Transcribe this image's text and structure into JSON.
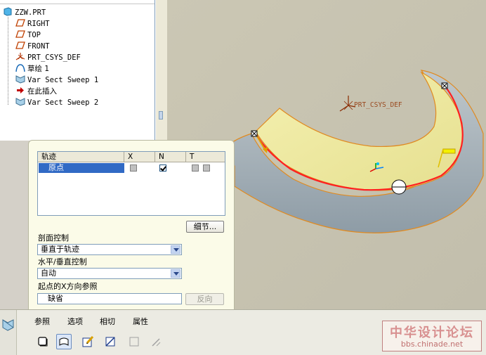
{
  "model_tree": {
    "items": [
      {
        "label": "ZZW.PRT",
        "icon": "part-icon"
      },
      {
        "label": "RIGHT",
        "icon": "datum-plane-icon"
      },
      {
        "label": "TOP",
        "icon": "datum-plane-icon"
      },
      {
        "label": "FRONT",
        "icon": "datum-plane-icon"
      },
      {
        "label": "PRT_CSYS_DEF",
        "icon": "csys-icon"
      },
      {
        "label": "草绘 1",
        "icon": "sketch-icon"
      },
      {
        "label": "Var Sect Sweep 1",
        "icon": "sweep-icon"
      },
      {
        "label": "在此插入",
        "icon": "insert-here-arrow-icon"
      },
      {
        "label": "Var Sect Sweep 2",
        "icon": "sweep-icon"
      }
    ]
  },
  "viewport": {
    "csys_label": "PRT_CSYS_DEF",
    "colors": {
      "background": "#c8c4b2",
      "surface_yellow": "#eeeaa0",
      "surface_gray": "#a8b4bc",
      "trajectory_red": "#ff2020",
      "edge_orange": "#e08a20"
    }
  },
  "ref_panel": {
    "table": {
      "headers": [
        "轨迹",
        "X",
        "N",
        "T"
      ],
      "row": {
        "name": "原点",
        "x_checked": false,
        "n_checked": true
      }
    },
    "details_button": "细节...",
    "section_control_label": "剖面控制",
    "section_control_value": "垂直于轨迹",
    "hv_control_label": "水平/垂直控制",
    "hv_control_value": "自动",
    "start_x_ref_label": "起点的X方向参照",
    "start_x_ref_value": "缺省",
    "flip_button": "反向"
  },
  "dashboard": {
    "tabs": [
      "参照",
      "选项",
      "相切",
      "属性"
    ],
    "tools": [
      "solid-icon",
      "surface-icon",
      "sketch-edit-icon",
      "variable-section-icon",
      "remove-material-icon",
      "thicken-icon"
    ]
  },
  "watermark": {
    "title": "中华设计论坛",
    "url": "bbs.chinade.net"
  }
}
